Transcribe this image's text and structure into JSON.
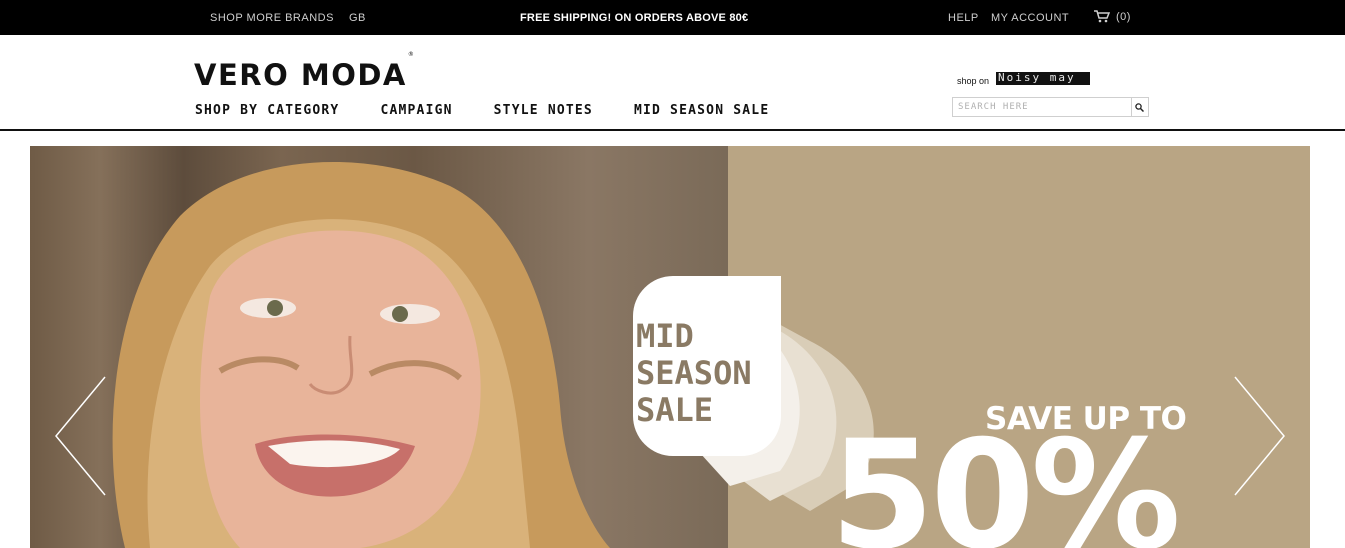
{
  "topbar": {
    "shop_more_brands": "SHOP MORE BRANDS",
    "region": "GB",
    "shipping_message": "FREE SHIPPING! ON ORDERS ABOVE 80€",
    "help": "HELP",
    "my_account": "MY ACCOUNT",
    "cart_count": "(0)",
    "cart_icon": "cart-icon"
  },
  "header": {
    "logo": "VERO MODA",
    "logo_mark": "®",
    "shop_on_label": "shop on",
    "shop_on_brand": "Noisy may",
    "search_placeholder": "SEARCH HERE",
    "search_icon": "search-icon"
  },
  "nav": {
    "items": [
      "SHOP BY CATEGORY",
      "CAMPAIGN",
      "STYLE NOTES",
      "MID SEASON SALE"
    ]
  },
  "hero": {
    "badge_lines": [
      "MID",
      "SEASON",
      "SALE"
    ],
    "save_text": "SAVE UP TO",
    "percent_text": "50%",
    "prev_icon": "chevron-left-icon",
    "next_icon": "chevron-right-icon",
    "tan_color": "#b9a584"
  },
  "colors": {
    "topbar": "#000000",
    "badge_text": "#8a7a64"
  }
}
